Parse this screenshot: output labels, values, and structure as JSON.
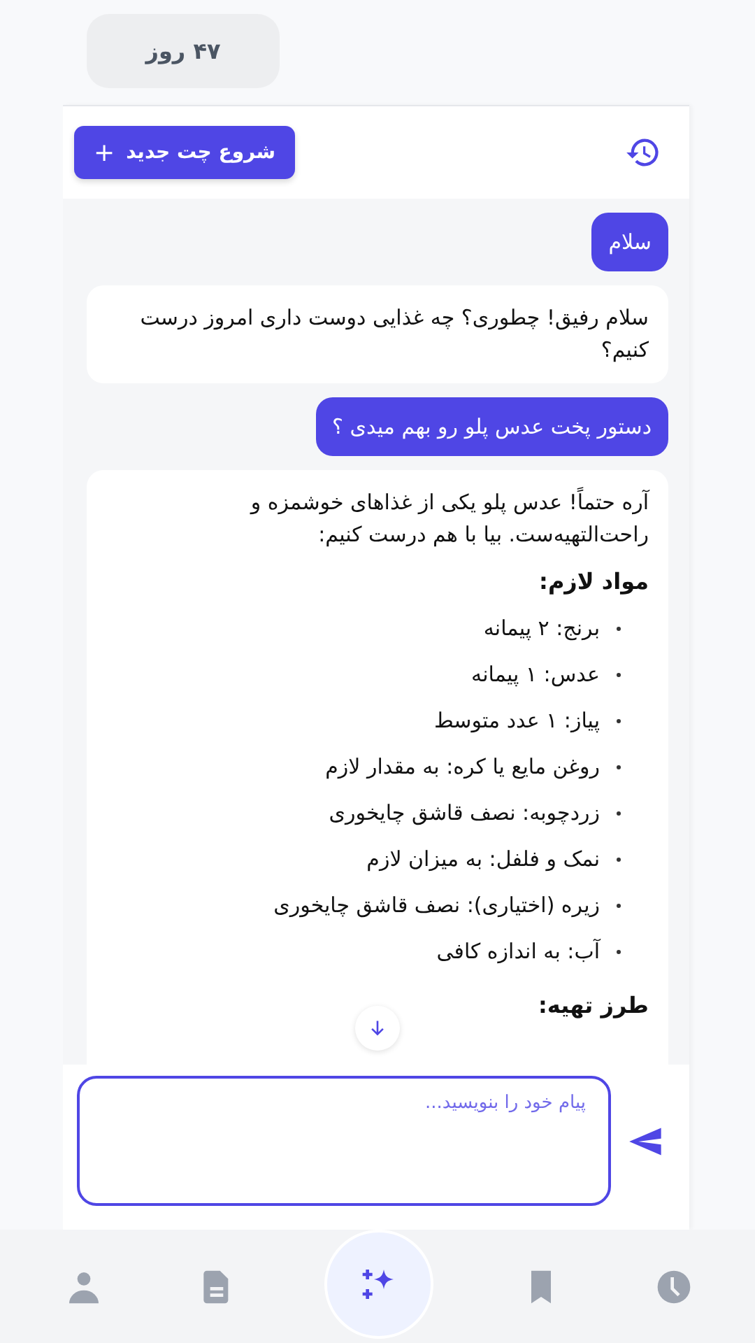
{
  "top_bar": {
    "days_badge": "۴۷ روز"
  },
  "header": {
    "new_chat_button": {
      "label": "شروع چت جدید",
      "icon": "+"
    }
  },
  "messages": [
    {
      "kind": "user",
      "text": "سلام"
    },
    {
      "kind": "assistant",
      "text": "سلام رفیق! چطوری؟ چه غذایی دوست داری امروز درست کنیم؟"
    },
    {
      "kind": "user",
      "text": "دستور پخت عدس پلو رو بهم میدی ؟"
    },
    {
      "kind": "recipe",
      "intro": "آره حتماً! عدس پلو یکی از غذاهای خوشمزه و راحت‌التهیه‌ست. بیا با هم درست کنیم:",
      "sections": [
        {
          "heading": "مواد لازم:",
          "items": [
            "برنج: ۲ پیمانه",
            "عدس: ۱ پیمانه",
            "پیاز: ۱ عدد متوسط",
            "روغن مایع یا کره: به مقدار لازم",
            "زردچوبه: نصف قاشق چایخوری",
            "نمک و فلفل: به میزان لازم",
            "زیره (اختیاری): نصف قاشق چایخوری",
            "آب: به اندازه کافی"
          ]
        },
        {
          "heading": "طرز تهیه:"
        }
      ]
    }
  ],
  "composer": {
    "placeholder": "پیام خود را بنویسید..."
  },
  "bottom_nav": [
    {
      "kind": "clock",
      "selected": false
    },
    {
      "kind": "bookmark",
      "selected": false
    },
    {
      "kind": "sparkle",
      "selected": true
    },
    {
      "kind": "document",
      "selected": false
    },
    {
      "kind": "person",
      "selected": false
    }
  ]
}
